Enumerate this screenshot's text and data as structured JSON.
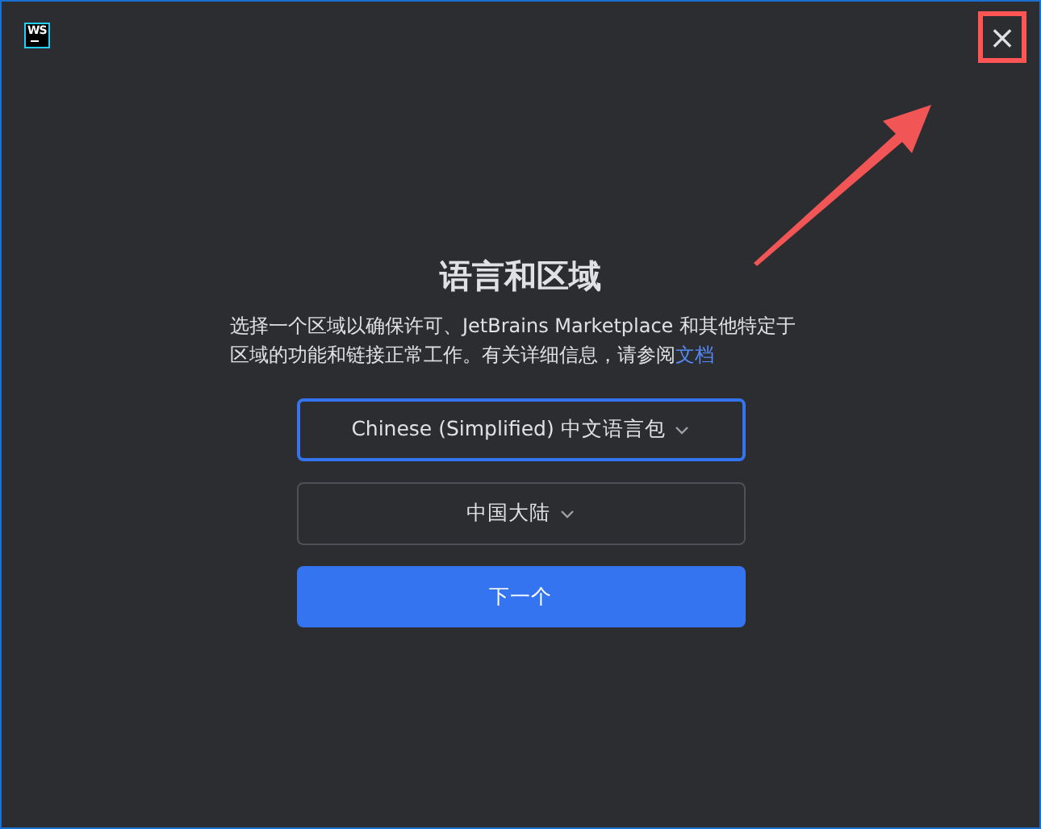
{
  "window": {
    "logo": "WS",
    "close": "×",
    "close_highlighted": true
  },
  "title": "语言和区域",
  "description": {
    "text": "选择一个区域以确保许可、JetBrains Marketplace 和其他特定于区域的功能和链接正常工作。有关详细信息，请参阅",
    "link": "文档"
  },
  "dropdowns": [
    {
      "value": "Chinese (Simplified) 中文语言包",
      "focused": true
    },
    {
      "value": "中国大陆",
      "focused": false
    }
  ],
  "next_button": "下一个",
  "annotation_arrow": true
}
